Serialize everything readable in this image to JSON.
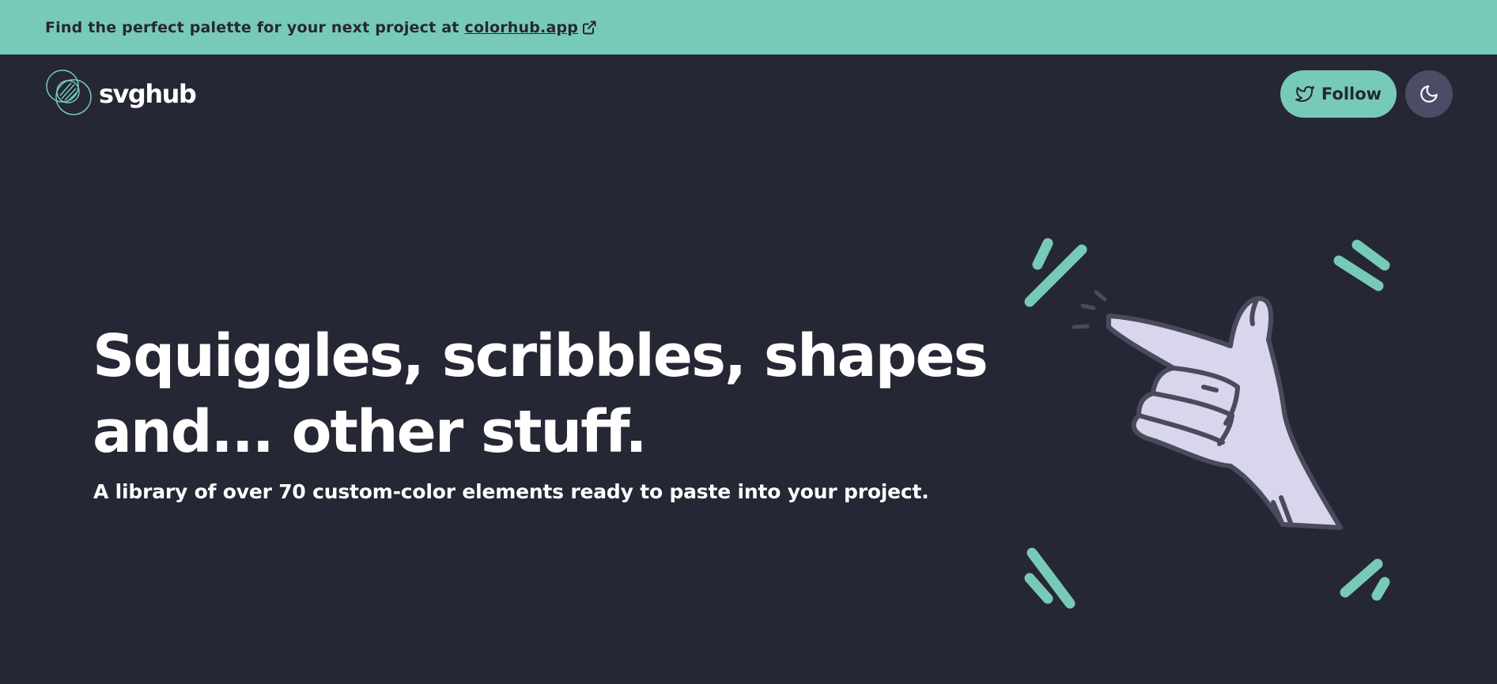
{
  "banner": {
    "text": "Find the perfect palette for your next project at",
    "link_text": "colorhub.app",
    "icon": "external-link-icon"
  },
  "logo": {
    "icon": "svghub-logo-icon",
    "text": "svghub"
  },
  "header": {
    "follow_label": "Follow",
    "follow_icon": "twitter-icon",
    "theme_icon": "moon-icon"
  },
  "hero": {
    "line1": "Squiggles, scribbles, shapes",
    "line2": "and... other stuff.",
    "subtitle": "A library of over 70 custom-color elements ready to paste into your project.",
    "illustration": "pointing-hand-illustration"
  },
  "colors": {
    "background": "#262735",
    "accent": "#78cab8",
    "text": "#ffffff",
    "theme_button": "#4c4c67",
    "hand_fill": "#d8d6ec",
    "hand_outline": "#4a4a5c"
  }
}
